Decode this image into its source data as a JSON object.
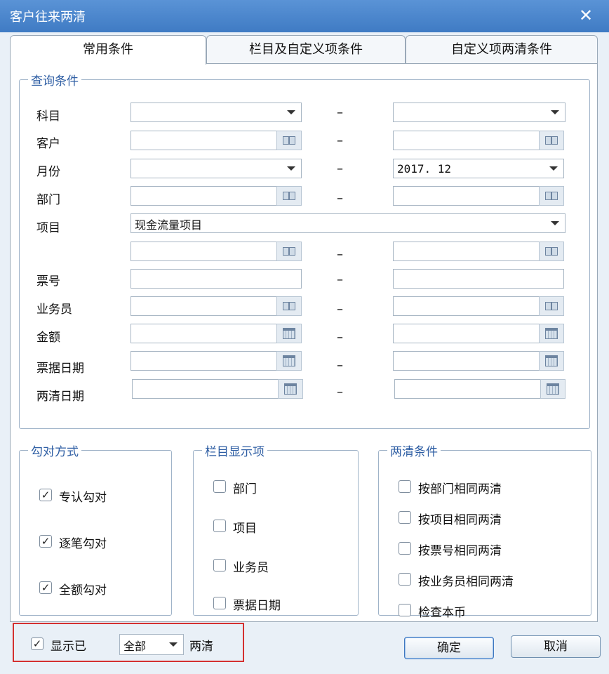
{
  "window": {
    "title": "客户往来两清",
    "close_icon": "✕"
  },
  "tabs": [
    {
      "label": "常用条件",
      "active": true
    },
    {
      "label": "栏目及自定义项条件",
      "active": false
    },
    {
      "label": "自定义项两清条件",
      "active": false
    }
  ],
  "query": {
    "legend": "查询条件",
    "dash": "–",
    "rows": [
      {
        "label": "科目",
        "from": "",
        "to": ""
      },
      {
        "label": "客户",
        "from": "",
        "to": ""
      },
      {
        "label": "月份",
        "from": "",
        "to": "2017. 12"
      },
      {
        "label": "部门",
        "from": "",
        "to": ""
      },
      {
        "label": "项目",
        "value": "现金流量项目"
      },
      {
        "label": "",
        "from": "",
        "to": ""
      },
      {
        "label": "票号",
        "from": "",
        "to": ""
      },
      {
        "label": "业务员",
        "from": "",
        "to": ""
      },
      {
        "label": "金额",
        "from": "",
        "to": ""
      },
      {
        "label": "票据日期",
        "from": "",
        "to": ""
      },
      {
        "label": "两清日期",
        "from": "",
        "to": ""
      }
    ]
  },
  "match_mode": {
    "legend": "勾对方式",
    "options": [
      {
        "label": "专认勾对",
        "checked": true
      },
      {
        "label": "逐笔勾对",
        "checked": true
      },
      {
        "label": "全额勾对",
        "checked": true
      }
    ]
  },
  "display_columns": {
    "legend": "栏目显示项",
    "options": [
      {
        "label": "部门",
        "checked": false
      },
      {
        "label": "项目",
        "checked": false
      },
      {
        "label": "业务员",
        "checked": false
      },
      {
        "label": "票据日期",
        "checked": false
      }
    ]
  },
  "clear_conditions": {
    "legend": "两清条件",
    "options": [
      {
        "label": "按部门相同两清",
        "checked": false
      },
      {
        "label": "按项目相同两清",
        "checked": false
      },
      {
        "label": "按票号相同两清",
        "checked": false
      },
      {
        "label": "按业务员相同两清",
        "checked": false
      },
      {
        "label": "检查本币",
        "checked": false
      }
    ]
  },
  "footer": {
    "show_label": "显示已",
    "show_checked": true,
    "scope_value": "全部",
    "suffix": "两清",
    "ok": "确定",
    "cancel": "取消"
  },
  "colors": {
    "title_bar": "#4a86cc",
    "legend_text": "#2d5da3",
    "highlight_border": "#d43030"
  }
}
